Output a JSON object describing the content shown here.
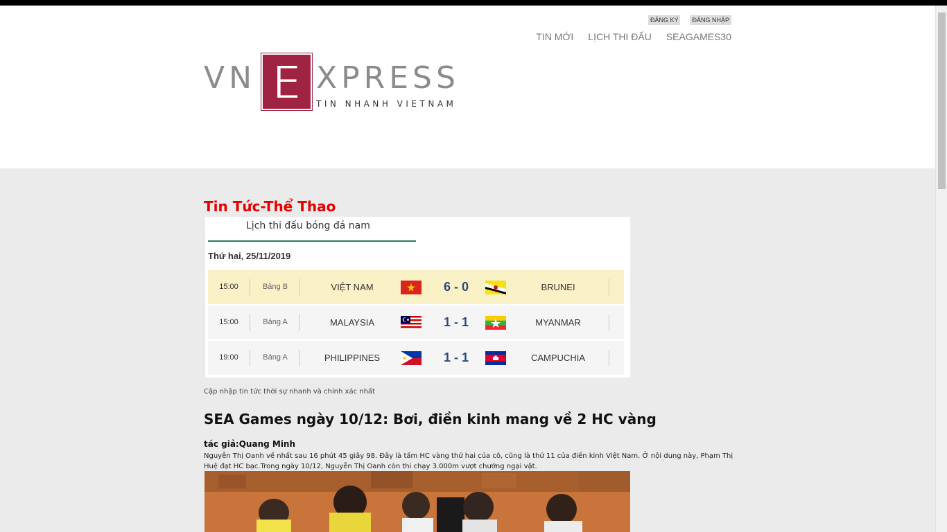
{
  "header": {
    "auth": {
      "register": "ĐĂNG KÝ",
      "login": "ĐĂNG NHẬP"
    },
    "nav": [
      "TIN MỚI",
      "LỊCH THI ĐẤU",
      "SEAGAMES30"
    ],
    "logo": {
      "left": "VN",
      "box": "E",
      "right": "XPRESS",
      "tagline": "TIN NHANH VIETNAM"
    }
  },
  "section_title": "Tin Tức-Thể Thao",
  "schedule": {
    "tab_label": "Lịch thi đấu bóng đá nam",
    "date": "Thứ hai, 25/11/2019",
    "matches": [
      {
        "time": "15:00",
        "group": "Bảng B",
        "home": "VIỆT NAM",
        "score": "6 - 0",
        "away": "BRUNEI"
      },
      {
        "time": "15:00",
        "group": "Bảng A",
        "home": "MALAYSIA",
        "score": "1 - 1",
        "away": "MYANMAR"
      },
      {
        "time": "19:00",
        "group": "Bảng A",
        "home": "PHILIPPINES",
        "score": "1 - 1",
        "away": "CAMPUCHIA"
      }
    ]
  },
  "update_note": "Cập nhập tin tức thời sự nhanh và chính xác nhất",
  "article": {
    "title": "SEA Games ngày 10/12: Bơi, điền kinh mang về 2 HC vàng",
    "author": "tác giả:Quang Minh",
    "summary": "Nguyễn Thị Oanh về nhất sau 16 phút 45 giây 98. Đây là tấm HC vàng thứ hai của cô, cũng là thứ 11 của điền kinh Việt Nam. Ở nội dung này, Phạm Thị Huệ đạt HC bạc.Trong ngày 10/12, Nguyễn Thị Oanh còn thi chạy 3.000m vượt chướng ngại vật."
  },
  "colors": {
    "brand": "#9f2342",
    "section_title": "#e60000",
    "score": "#2b4a7a",
    "highlight_row": "#fbf1c6"
  }
}
